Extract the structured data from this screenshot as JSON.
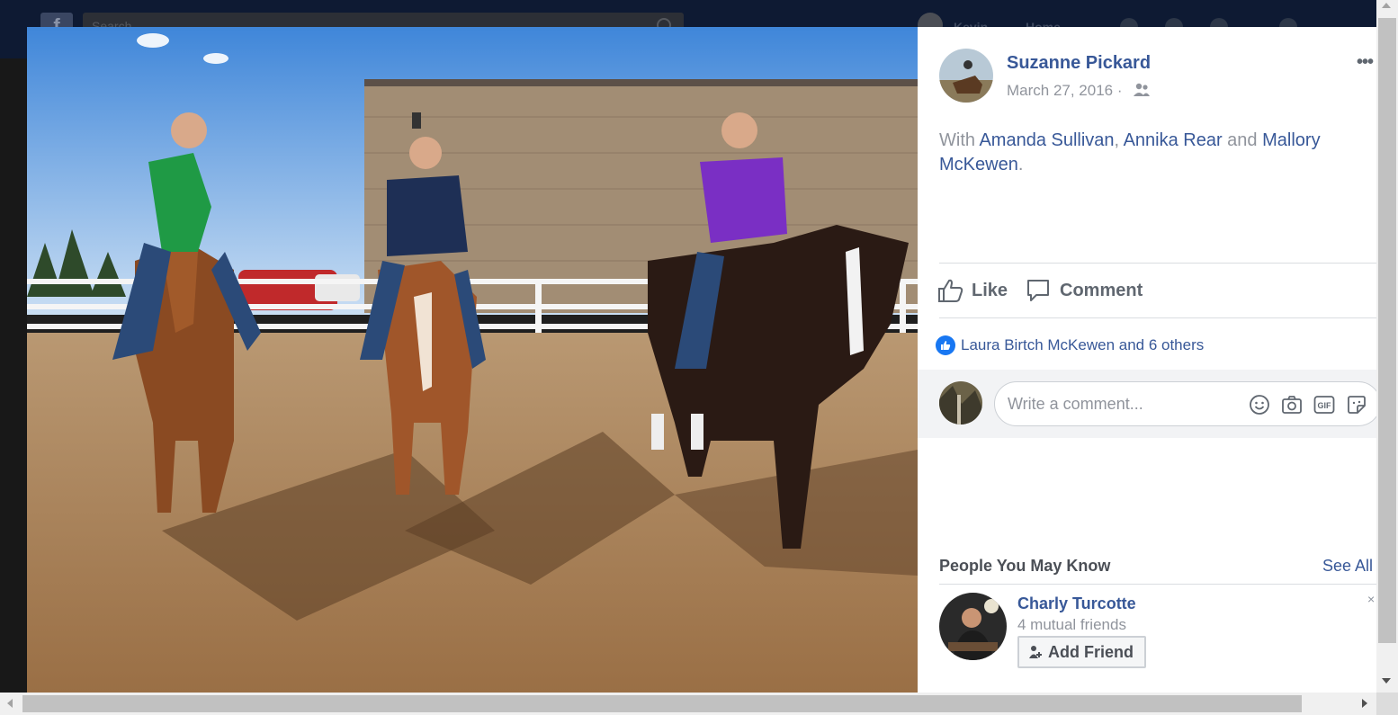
{
  "topbar": {
    "logo": "f",
    "search_placeholder": "Search",
    "user_name": "Kevin",
    "home_label": "Home"
  },
  "photo": {
    "description_icon": "photo-of-three-riders-on-horses"
  },
  "post": {
    "author": "Suzanne Pickard",
    "date": "March 27, 2016 ·",
    "audience_icon": "friends-icon",
    "more": "•••",
    "with_prefix": "With ",
    "tagged_1": "Amanda Sullivan",
    "sep_1": ", ",
    "tagged_2": "Annika Rear",
    "sep_2": " and ",
    "tagged_3": "Mallory McKewen",
    "with_suffix": "."
  },
  "actions": {
    "like_label": "Like",
    "comment_label": "Comment"
  },
  "reactions": {
    "text": "Laura Birtch McKewen and 6 others"
  },
  "comment_box": {
    "placeholder": "Write a comment...",
    "icons": [
      "emoji-icon",
      "camera-icon",
      "gif-icon",
      "sticker-icon"
    ],
    "gif_text": "GIF"
  },
  "people_you_may_know": {
    "title": "People You May Know",
    "see_all": "See All",
    "suggestion": {
      "name": "Charly Turcotte",
      "mutual": "4 mutual friends",
      "button": "Add Friend",
      "close": "×"
    }
  },
  "colors": {
    "link": "#385898",
    "muted": "#90949c",
    "like_blue": "#1877f2"
  }
}
